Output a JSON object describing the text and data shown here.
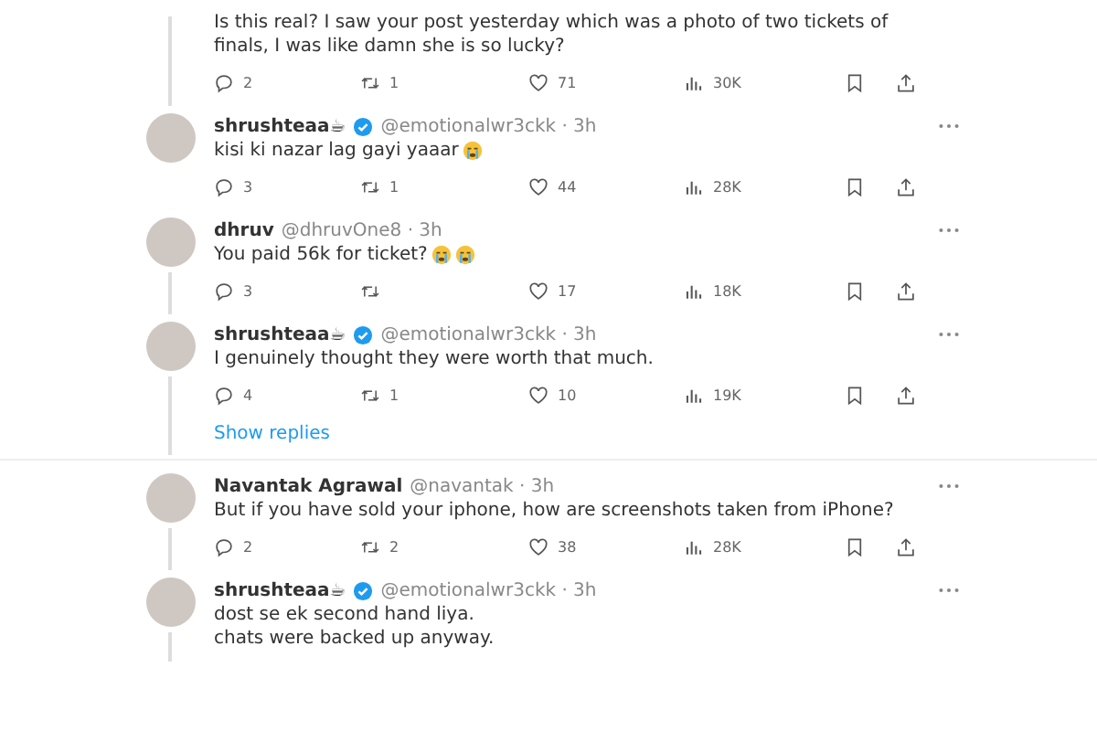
{
  "replies": [
    {
      "lines": [
        "Is this real? I saw your post yesterday which was a photo of two tickets of",
        "finals, I was like damn she is so lucky?"
      ],
      "thread": true,
      "actions": {
        "replies": "2",
        "reposts": "1",
        "likes": "71",
        "views": "30K"
      }
    },
    {
      "name": "shrushteaa☕",
      "verified": true,
      "handle": "@emotionalwr3ckk · 3h",
      "lines": [
        "kisi ki nazar lag gayi yaaar"
      ],
      "emojis": [
        {
          "kind": "crying"
        }
      ],
      "actions": {
        "replies": "3",
        "reposts": "1",
        "likes": "44",
        "views": "28K"
      }
    },
    {
      "name": "dhruv",
      "handle": "@dhruvOne8 · 3h",
      "lines": [
        "You paid 56k for ticket?"
      ],
      "emojis": [
        {
          "kind": "crying"
        },
        {
          "kind": "crying"
        }
      ],
      "thread": true,
      "actions": {
        "replies": "3",
        "likes": "17",
        "views": "18K"
      }
    },
    {
      "name": "shrushteaa☕",
      "verified": true,
      "handle": "@emotionalwr3ckk · 3h",
      "lines": [
        "I genuinely thought they were worth that much."
      ],
      "thread": true,
      "actions": {
        "replies": "4",
        "reposts": "1",
        "likes": "10",
        "views": "19K"
      },
      "show_replies": "Show replies"
    },
    {
      "name": "Navantak Agrawal",
      "handle": "@navantak · 3h",
      "lines": [
        "But if you have sold your iphone, how are screenshots taken from iPhone?"
      ],
      "thread": true,
      "actions": {
        "replies": "2",
        "reposts": "2",
        "likes": "38",
        "views": "28K"
      }
    },
    {
      "name": "shrushteaa☕",
      "verified": true,
      "handle": "@emotionalwr3ckk · 3h",
      "lines": [
        "dost se ek second hand liya.",
        "chats were backed up anyway."
      ],
      "thread": true
    }
  ]
}
